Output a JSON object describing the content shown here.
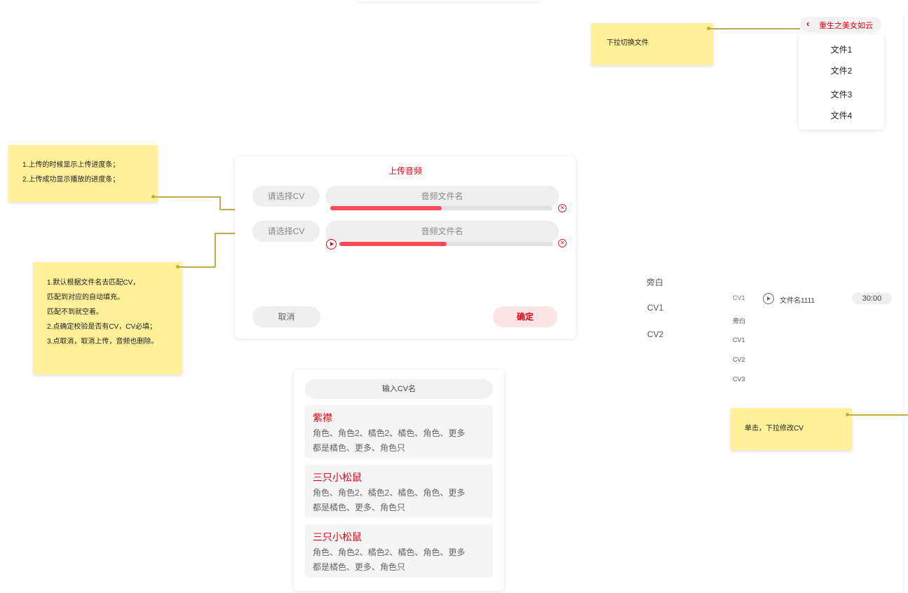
{
  "notes": {
    "switch_file": "下拉切换文件",
    "progress": [
      "1.上传的时候显示上传进度条；",
      "2.上传成功显示播放的进度条；"
    ],
    "cv_rules": [
      "1.默认根据文件名去匹配CV，",
      "匹配到对应的自动填充。",
      "匹配不到就空着。",
      "2.点确定校验是否有CV，CV必填；",
      "3.点取消，取消上传，音频也删除。"
    ],
    "click_cv": "单击，下拉修改CV"
  },
  "file_dropdown": {
    "title": "重生之美女如云",
    "options": [
      "文件1",
      "文件2",
      "文件3",
      "文件4"
    ]
  },
  "upload_dialog": {
    "title": "上传音频",
    "rows": [
      {
        "cv_placeholder": "请选择CV",
        "file_placeholder": "音频文件名",
        "progress": 0.5
      },
      {
        "cv_placeholder": "请选择CV",
        "file_placeholder": "音频文件名",
        "progress": 0.5
      }
    ],
    "cancel": "取消",
    "confirm": "确定"
  },
  "cv_picker": {
    "search_placeholder": "输入CV名",
    "items": [
      {
        "name": "紫襟",
        "line1": "角色、角色2、橘色2、橘色、角色、更多",
        "line2": "都是橘色、更多、角色只"
      },
      {
        "name": "三只小松鼠",
        "line1": "角色、角色2、橘色2、橘色、角色、更多",
        "line2": "都是橘色、更多、角色只"
      },
      {
        "name": "三只小松鼠",
        "line1": "角色、角色2、橘色2、橘色、角色、更多",
        "line2": "都是橘色、更多、角色只"
      }
    ]
  },
  "cv_column": [
    "旁白",
    "CV1",
    "CV2"
  ],
  "audio_row": {
    "cv": "CV1",
    "filename": "文件名1111",
    "duration": "30:00"
  },
  "cv_options": [
    "旁白",
    "CV1",
    "CV2",
    "CV3"
  ],
  "colors": {
    "accent": "#e60012",
    "sticky": "#fff099",
    "progress": "#ff4b55"
  }
}
